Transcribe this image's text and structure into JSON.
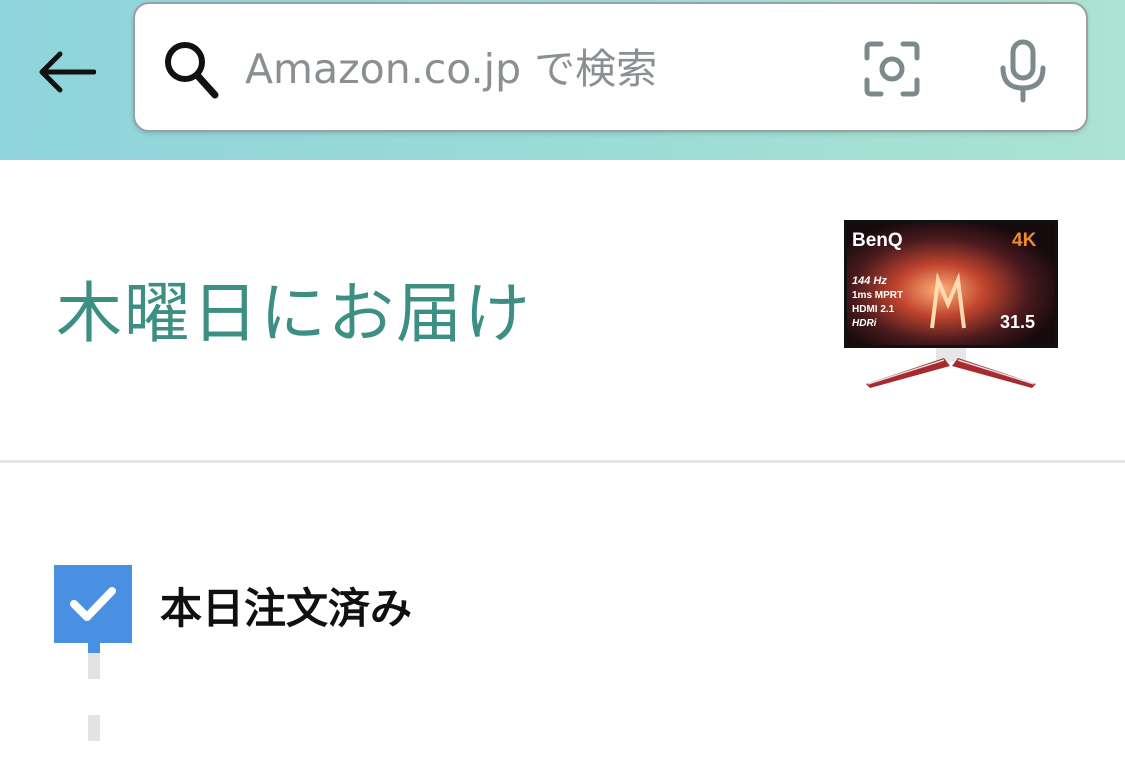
{
  "search": {
    "placeholder": "Amazon.co.jp で検索"
  },
  "delivery": {
    "title": "木曜日にお届け",
    "product_image": {
      "brand": "BenQ",
      "badge": "4K",
      "specs": [
        "144 Hz",
        "1ms MPRT",
        "HDMI 2.1",
        "HDRi"
      ],
      "size": "31.5"
    }
  },
  "status": {
    "label": "本日注文済み",
    "checked": true
  },
  "colors": {
    "accent_teal": "#3e8f83",
    "check_blue": "#4a90e2"
  }
}
